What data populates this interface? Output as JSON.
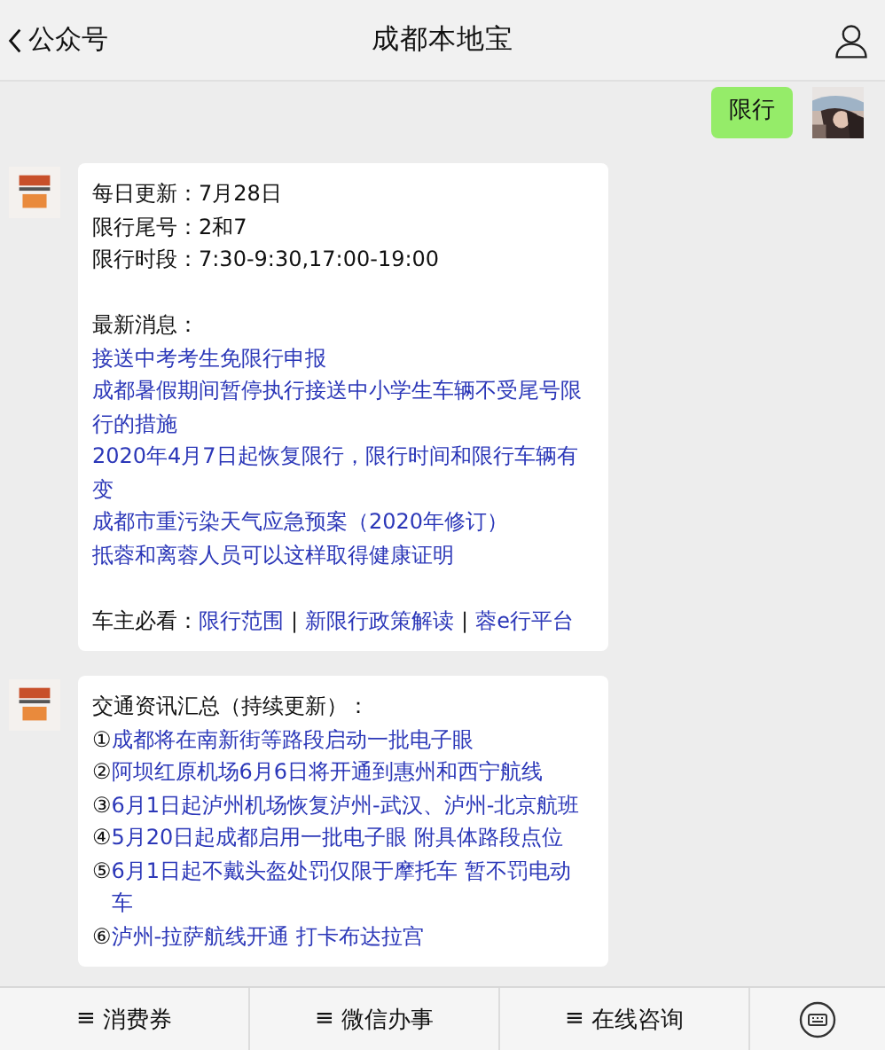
{
  "header": {
    "back_label": "公众号",
    "title": "成都本地宝"
  },
  "messages": [
    {
      "kind": "sent",
      "lines": [
        {
          "kind": "text",
          "text": "限行"
        }
      ]
    },
    {
      "kind": "received",
      "lines": [
        {
          "kind": "text",
          "text": "每日更新：7月28日"
        },
        {
          "kind": "text",
          "text": "限行尾号：2和7"
        },
        {
          "kind": "text",
          "text": "限行时段：7:30-9:30,17:00-19:00"
        },
        {
          "kind": "blank"
        },
        {
          "kind": "text",
          "text": "最新消息："
        },
        {
          "kind": "link",
          "text": "接送中考考生免限行申报"
        },
        {
          "kind": "link",
          "text": "成都暑假期间暂停执行接送中小学生车辆不受尾号限行的措施"
        },
        {
          "kind": "link",
          "text": "2020年4月7日起恢复限行，限行时间和限行车辆有变"
        },
        {
          "kind": "link",
          "text": "成都市重污染天气应急预案（2020年修订）"
        },
        {
          "kind": "link",
          "text": "抵蓉和离蓉人员可以这样取得健康证明"
        },
        {
          "kind": "blank"
        },
        {
          "kind": "links",
          "label": "车主必看：",
          "links": [
            "限行范围",
            "新限行政策解读",
            "蓉e行平台"
          ],
          "separator": "|"
        }
      ]
    },
    {
      "kind": "received",
      "lines": [
        {
          "kind": "text",
          "text": "交通资讯汇总（持续更新）："
        },
        {
          "kind": "item",
          "marker": "①",
          "text": "成都将在南新街等路段启动一批电子眼"
        },
        {
          "kind": "item",
          "marker": "②",
          "text": "阿坝红原机场6月6日将开通到惠州和西宁航线"
        },
        {
          "kind": "item",
          "marker": "③",
          "text": "6月1日起泸州机场恢复泸州-武汉、泸州-北京航班"
        },
        {
          "kind": "item",
          "marker": "④",
          "text": "5月20日起成都启用一批电子眼 附具体路段点位"
        },
        {
          "kind": "item",
          "marker": "⑤",
          "text": "6月1日起不戴头盔处罚仅限于摩托车 暂不罚电动车"
        },
        {
          "kind": "item",
          "marker": "⑥",
          "text": "泸州-拉萨航线开通 打卡布达拉宫"
        }
      ]
    }
  ],
  "menu": [
    {
      "label": "消费券",
      "mark": "≡"
    },
    {
      "label": "微信办事",
      "mark": "≡"
    },
    {
      "label": "在线咨询",
      "mark": "≡"
    }
  ]
}
